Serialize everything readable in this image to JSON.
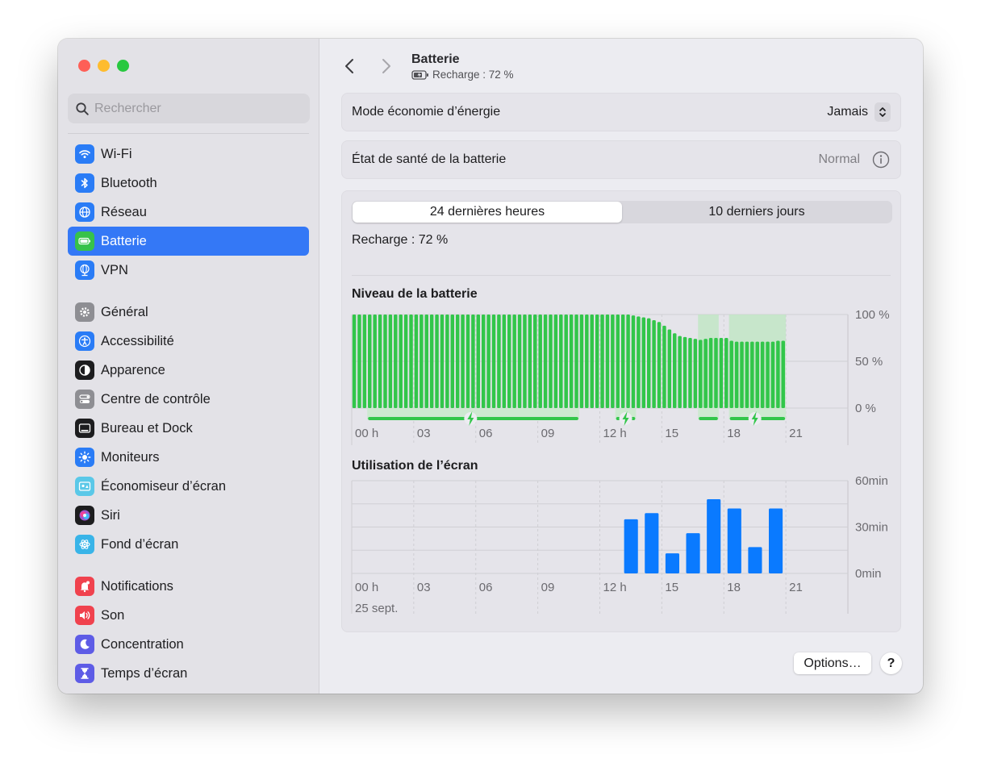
{
  "window": {
    "title": "Batterie",
    "subtitle": "Recharge : 72 %"
  },
  "search": {
    "placeholder": "Rechercher"
  },
  "sidebar": {
    "groups": [
      [
        {
          "label": "Wi-Fi",
          "icon": "wifi-icon",
          "color": "#2a7cf6"
        },
        {
          "label": "Bluetooth",
          "icon": "bluetooth-icon",
          "color": "#2a7cf6"
        },
        {
          "label": "Réseau",
          "icon": "globe-icon",
          "color": "#2a7cf6"
        },
        {
          "label": "Batterie",
          "icon": "battery-icon",
          "color": "#37c24a",
          "active": true
        },
        {
          "label": "VPN",
          "icon": "vpn-globe-icon",
          "color": "#2a7cf6"
        }
      ],
      [
        {
          "label": "Général",
          "icon": "gear-icon",
          "color": "#8e8e93"
        },
        {
          "label": "Accessibilité",
          "icon": "accessibility-icon",
          "color": "#2a7cf6"
        },
        {
          "label": "Apparence",
          "icon": "appearance-icon",
          "color": "#1d1d1f"
        },
        {
          "label": "Centre de contrôle",
          "icon": "control-center-icon",
          "color": "#8e8e93"
        },
        {
          "label": "Bureau et Dock",
          "icon": "dock-icon",
          "color": "#1d1d1f"
        },
        {
          "label": "Moniteurs",
          "icon": "sun-icon",
          "color": "#2a7cf6"
        },
        {
          "label": "Économiseur d’écran",
          "icon": "screensaver-icon",
          "color": "#5ac8e8"
        },
        {
          "label": "Siri",
          "icon": "siri-icon",
          "color": "#1d1d1f"
        },
        {
          "label": "Fond d’écran",
          "icon": "wallpaper-icon",
          "color": "#39b4e8"
        }
      ],
      [
        {
          "label": "Notifications",
          "icon": "bell-icon",
          "color": "#f0424e"
        },
        {
          "label": "Son",
          "icon": "speaker-icon",
          "color": "#f0424e"
        },
        {
          "label": "Concentration",
          "icon": "moon-icon",
          "color": "#5e5ce6"
        },
        {
          "label": "Temps d’écran",
          "icon": "hourglass-icon",
          "color": "#5e5ce6"
        }
      ]
    ]
  },
  "settings": {
    "low_power": {
      "label": "Mode économie d’énergie",
      "value": "Jamais"
    },
    "health": {
      "label": "État de santé de la batterie",
      "value": "Normal"
    }
  },
  "usage": {
    "tabs": [
      {
        "label": "24 dernières heures",
        "selected": true
      },
      {
        "label": "10 derniers jours",
        "selected": false
      }
    ],
    "recharge_text": "Recharge : 72 %"
  },
  "colors": {
    "accent": "#3478f6",
    "battery_green": "#32c64a",
    "screen_blue": "#0a7aff"
  },
  "chart_data": [
    {
      "type": "bar",
      "title": "Niveau de la batterie",
      "x_tick_labels": [
        "00 h",
        "03",
        "06",
        "09",
        "12 h",
        "15",
        "18",
        "21"
      ],
      "y_tick_labels": [
        "100 %",
        "50 %",
        "0 %"
      ],
      "ylim": [
        0,
        100
      ],
      "bar_count": 84,
      "values": [
        100,
        100,
        100,
        100,
        100,
        100,
        100,
        100,
        100,
        100,
        100,
        100,
        100,
        100,
        100,
        100,
        100,
        100,
        100,
        100,
        100,
        100,
        100,
        100,
        100,
        100,
        100,
        100,
        100,
        100,
        100,
        100,
        100,
        100,
        100,
        100,
        100,
        100,
        100,
        100,
        100,
        100,
        100,
        100,
        100,
        100,
        100,
        100,
        100,
        100,
        100,
        100,
        100,
        100,
        99,
        98,
        97,
        96,
        94,
        92,
        88,
        84,
        80,
        77,
        76,
        75,
        74,
        73,
        74,
        75,
        75,
        75,
        75,
        72,
        71,
        71,
        71,
        71,
        71,
        71,
        71,
        71,
        72,
        72
      ],
      "charging_spans": [
        [
          3,
          44
        ],
        [
          51,
          55
        ],
        [
          67,
          71
        ],
        [
          73,
          84
        ]
      ],
      "charging_icons": [
        23,
        53,
        78
      ]
    },
    {
      "type": "bar",
      "title": "Utilisation de l’écran",
      "x_tick_labels": [
        "00 h",
        "03",
        "06",
        "09",
        "12 h",
        "15",
        "18",
        "21"
      ],
      "date_label": "25 sept.",
      "y_tick_labels": [
        "60min",
        "30min",
        "0min"
      ],
      "ylim": [
        0,
        60
      ],
      "hours": [
        13,
        14,
        15,
        16,
        17,
        18,
        19,
        20
      ],
      "values": [
        35,
        39,
        13,
        26,
        48,
        42,
        17,
        42
      ]
    }
  ],
  "footer": {
    "options_label": "Options…",
    "help_label": "?"
  }
}
